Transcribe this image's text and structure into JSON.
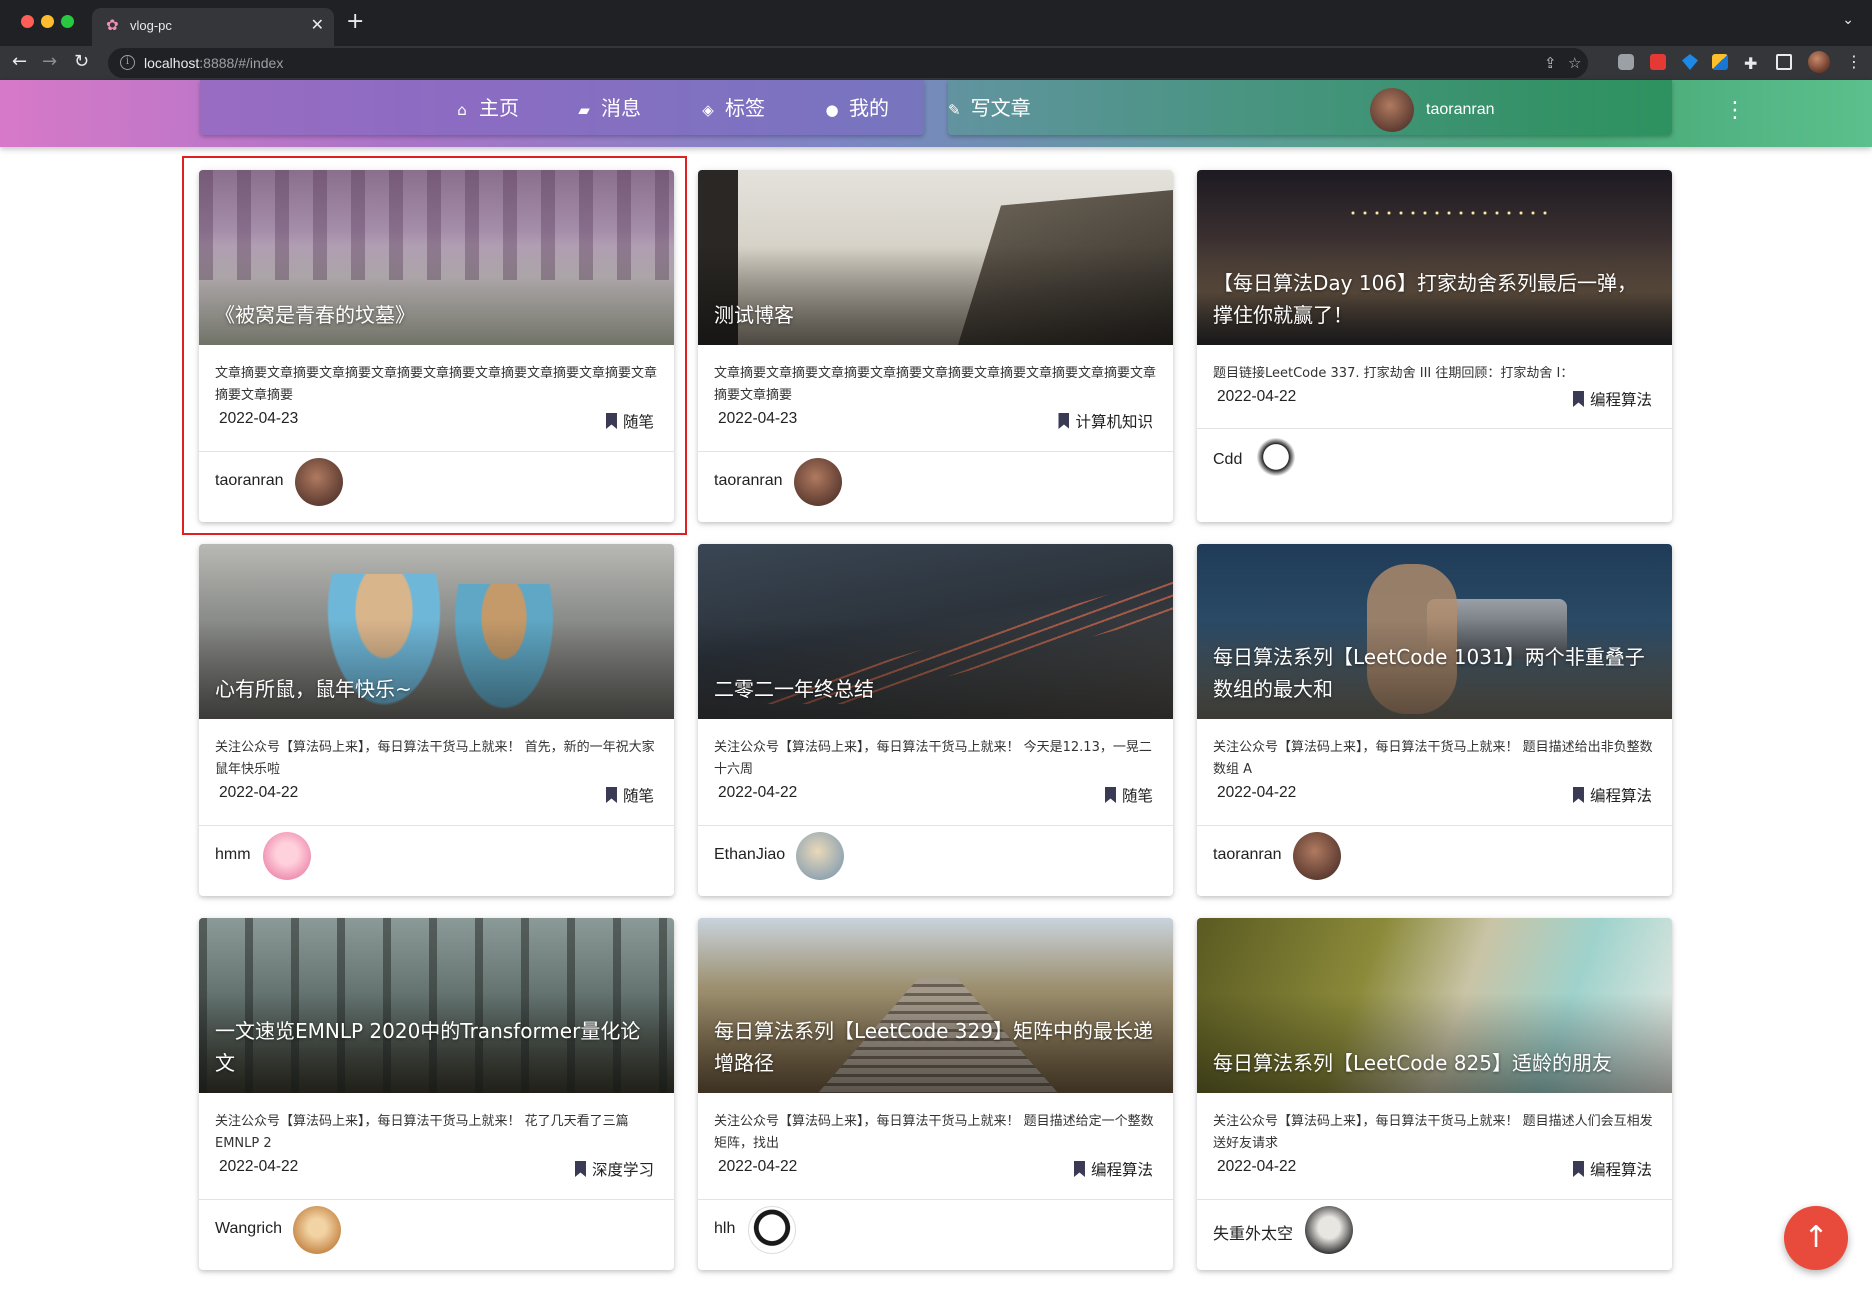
{
  "browser": {
    "tab_title": "vlog-pc",
    "url_host": "localhost",
    "url_rest": ":8888/#/index"
  },
  "header": {
    "nav": [
      {
        "label": "主页",
        "icon": "home-icon"
      },
      {
        "label": "消息",
        "icon": "message-icon"
      },
      {
        "label": "标签",
        "icon": "tag-icon"
      },
      {
        "label": "我的",
        "icon": "person-icon"
      }
    ],
    "write_label": "写文章",
    "username": "taoranran"
  },
  "cards": [
    {
      "title": "《被窝是青春的坟墓》",
      "summary": "文章摘要文章摘要文章摘要文章摘要文章摘要文章摘要文章摘要文章摘要文章摘要文章摘要",
      "date": "2022-04-23",
      "tag": "随笔",
      "author": "taoranran"
    },
    {
      "title": "测试博客",
      "summary": "文章摘要文章摘要文章摘要文章摘要文章摘要文章摘要文章摘要文章摘要文章摘要文章摘要",
      "date": "2022-04-23",
      "tag": "计算机知识",
      "author": "taoranran"
    },
    {
      "title": "【每日算法Day 106】打家劫舍系列最后一弹，撑住你就赢了！",
      "summary": "题目链接LeetCode 337. 打家劫舍 III 往期回顾：打家劫舍 I：",
      "date": "2022-04-22",
      "tag": "编程算法",
      "author": "Cdd"
    },
    {
      "title": "心有所鼠，鼠年快乐~",
      "summary": "关注公众号【算法码上来】，每日算法干货马上就来！ 首先，新的一年祝大家鼠年快乐啦",
      "date": "2022-04-22",
      "tag": "随笔",
      "author": "hmm"
    },
    {
      "title": "二零二一年终总结",
      "summary": "关注公众号【算法码上来】，每日算法干货马上就来！ 今天是12.13，一晃二十六周",
      "date": "2022-04-22",
      "tag": "随笔",
      "author": "EthanJiao"
    },
    {
      "title": "每日算法系列【LeetCode 1031】两个非重叠子数组的最大和",
      "summary": "关注公众号【算法码上来】，每日算法干货马上就来！ 题目描述给出非负整数数组 A",
      "date": "2022-04-22",
      "tag": "编程算法",
      "author": "taoranran"
    },
    {
      "title": "一文速览EMNLP 2020中的Transformer量化论文",
      "summary": "关注公众号【算法码上来】，每日算法干货马上就来！ 花了几天看了三篇EMNLP 2",
      "date": "2022-04-22",
      "tag": "深度学习",
      "author": "Wangrich"
    },
    {
      "title": "每日算法系列【LeetCode 329】矩阵中的最长递增路径",
      "summary": "关注公众号【算法码上来】，每日算法干货马上就来！ 题目描述给定一个整数矩阵，找出",
      "date": "2022-04-22",
      "tag": "编程算法",
      "author": "hlh"
    },
    {
      "title": "每日算法系列【LeetCode 825】适龄的朋友",
      "summary": "关注公众号【算法码上来】，每日算法干货马上就来！ 题目描述人们会互相发送好友请求",
      "date": "2022-04-22",
      "tag": "编程算法",
      "author": "失重外太空"
    }
  ]
}
